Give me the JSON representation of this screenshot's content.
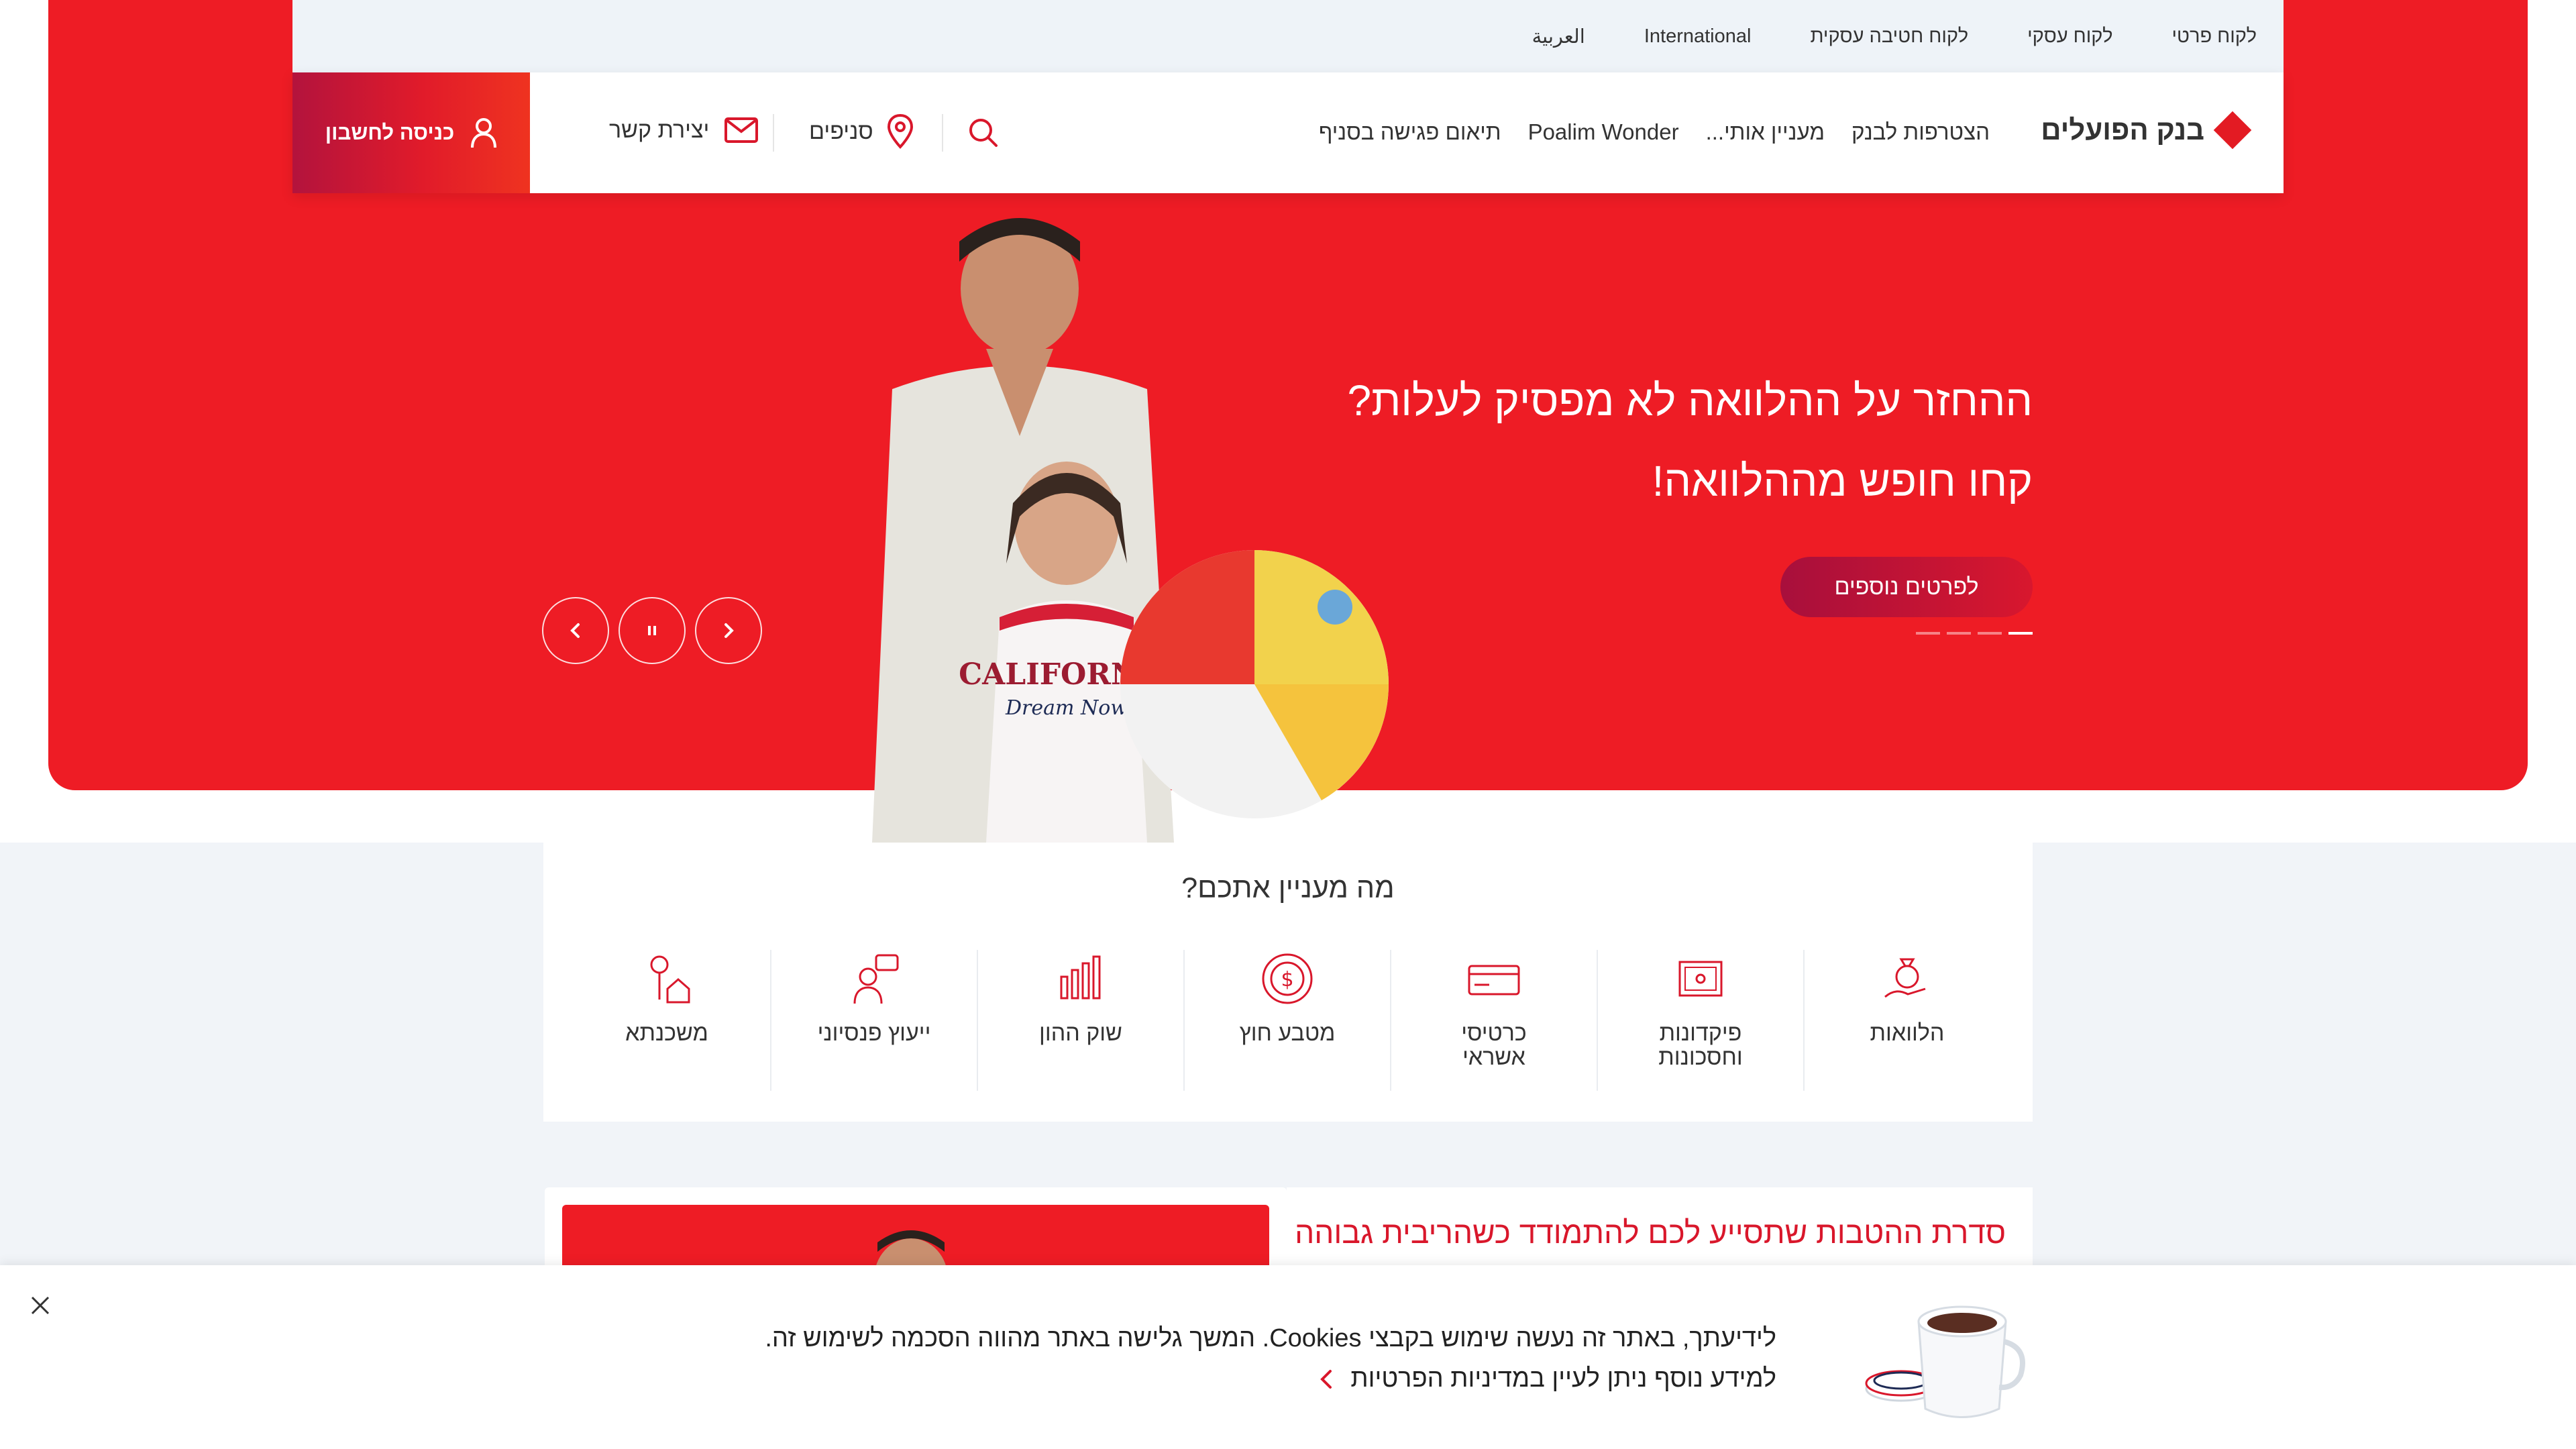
{
  "utility_nav": {
    "items": [
      "לקוח פרטי",
      "לקוח עסקי",
      "לקוח חטיבה עסקית",
      "International",
      "العربية"
    ]
  },
  "header": {
    "logo_text": "בנק הפועלים",
    "nav_items": [
      "הצטרפות לבנק",
      "מעניין אותי...",
      "Poalim Wonder",
      "תיאום פגישה בסניף"
    ],
    "branches_label": "סניפים",
    "contact_label": "יצירת קשר",
    "login_label": "כניסה לחשבון"
  },
  "hero": {
    "title_line1": "ההחזר על ההלוואה לא מפסיק לעלות?",
    "title_line2": "קחו חופש מההלוואה!",
    "cta_label": "לפרטים נוספים",
    "slide_count": 4,
    "active_slide": 1
  },
  "interests": {
    "title": "מה מעניין אתכם?",
    "items": [
      {
        "label": "הלוואות",
        "icon": "money-bag-hand-icon"
      },
      {
        "label": "פיקדונות וחסכונות",
        "icon": "safe-icon"
      },
      {
        "label": "כרטיסי אשראי",
        "icon": "credit-card-icon"
      },
      {
        "label": "מטבע חוץ",
        "icon": "coins-dollar-icon"
      },
      {
        "label": "שוק ההון",
        "icon": "bar-chart-icon"
      },
      {
        "label": "ייעוץ פנסיוני",
        "icon": "advisor-icon"
      },
      {
        "label": "משכנתא",
        "icon": "house-key-icon"
      }
    ]
  },
  "promo": {
    "title": "סדרת ההטבות שתסייע לכם להתמודד כשהריבית גבוהה"
  },
  "cookie_banner": {
    "text": "לידיעתך, באתר זה נעשה שימוש בקבצי Cookies. המשך גלישה באתר מהווה הסכמה לשימוש זה.",
    "link": "למידע נוסף ניתן לעיין במדיניות הפרטיות"
  },
  "colors": {
    "brand_red": "#ee1c25",
    "dark_red": "#b3133d",
    "grey_bg": "#f1f4f8"
  }
}
